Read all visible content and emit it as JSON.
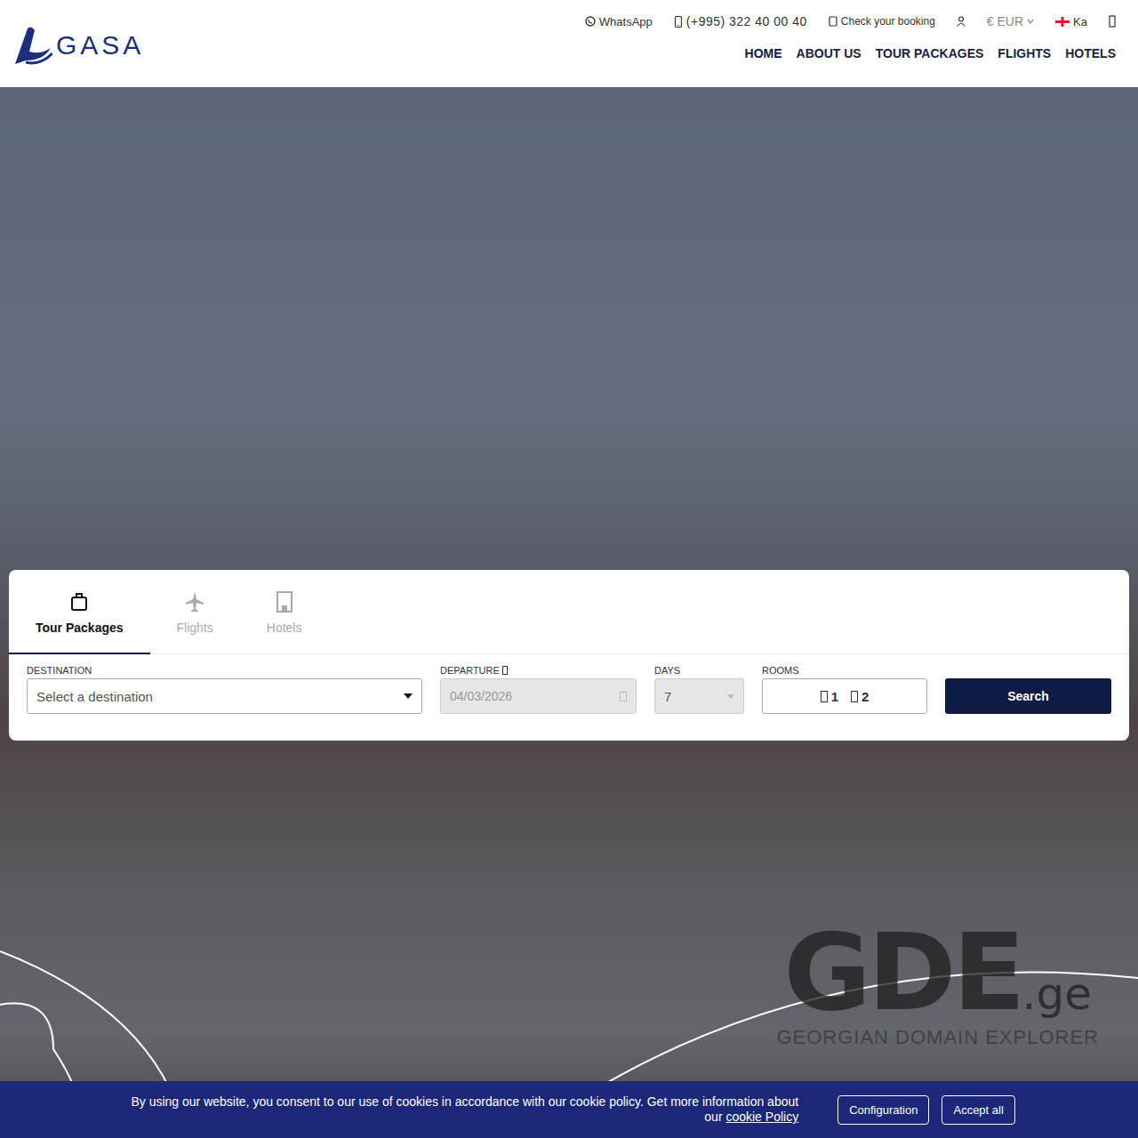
{
  "logo": {
    "text": "GASA"
  },
  "topbar": {
    "whatsapp": "WhatsApp",
    "phone": "(+995) 322 40 00 40",
    "booking": "Check your booking",
    "currency": "€ EUR",
    "language": "Ka"
  },
  "nav": [
    {
      "label": "HOME",
      "selected": true
    },
    {
      "label": "ABOUT US",
      "selected": false
    },
    {
      "label": "TOUR PACKAGES",
      "selected": false
    },
    {
      "label": "FLIGHTS",
      "selected": false
    },
    {
      "label": "HOTELS",
      "selected": false
    }
  ],
  "search": {
    "tabs": [
      {
        "label": "Tour Packages",
        "selected": true
      },
      {
        "label": "Flights",
        "selected": false
      },
      {
        "label": "Hotels",
        "selected": false
      }
    ],
    "destination": {
      "label": "DESTINATION",
      "placeholder": "Select a destination"
    },
    "departure": {
      "label": "DEPARTURE",
      "value": "04/03/2026",
      "disabled": true
    },
    "days": {
      "label": "DAYS",
      "value": "7",
      "disabled": true
    },
    "rooms": {
      "label": "ROOMS",
      "rooms": "1",
      "guests": "2"
    },
    "button": "Search"
  },
  "watermark": {
    "brand": "GDE",
    "tld": ".ge",
    "tagline": "GEORGIAN DOMAIN EXPLORER"
  },
  "cookie": {
    "text": "By using our website, you consent to our use of cookies in accordance with our cookie policy. Get more information about our ",
    "link": "cookie Policy",
    "buttons": [
      "Configuration",
      "Accept all"
    ]
  }
}
